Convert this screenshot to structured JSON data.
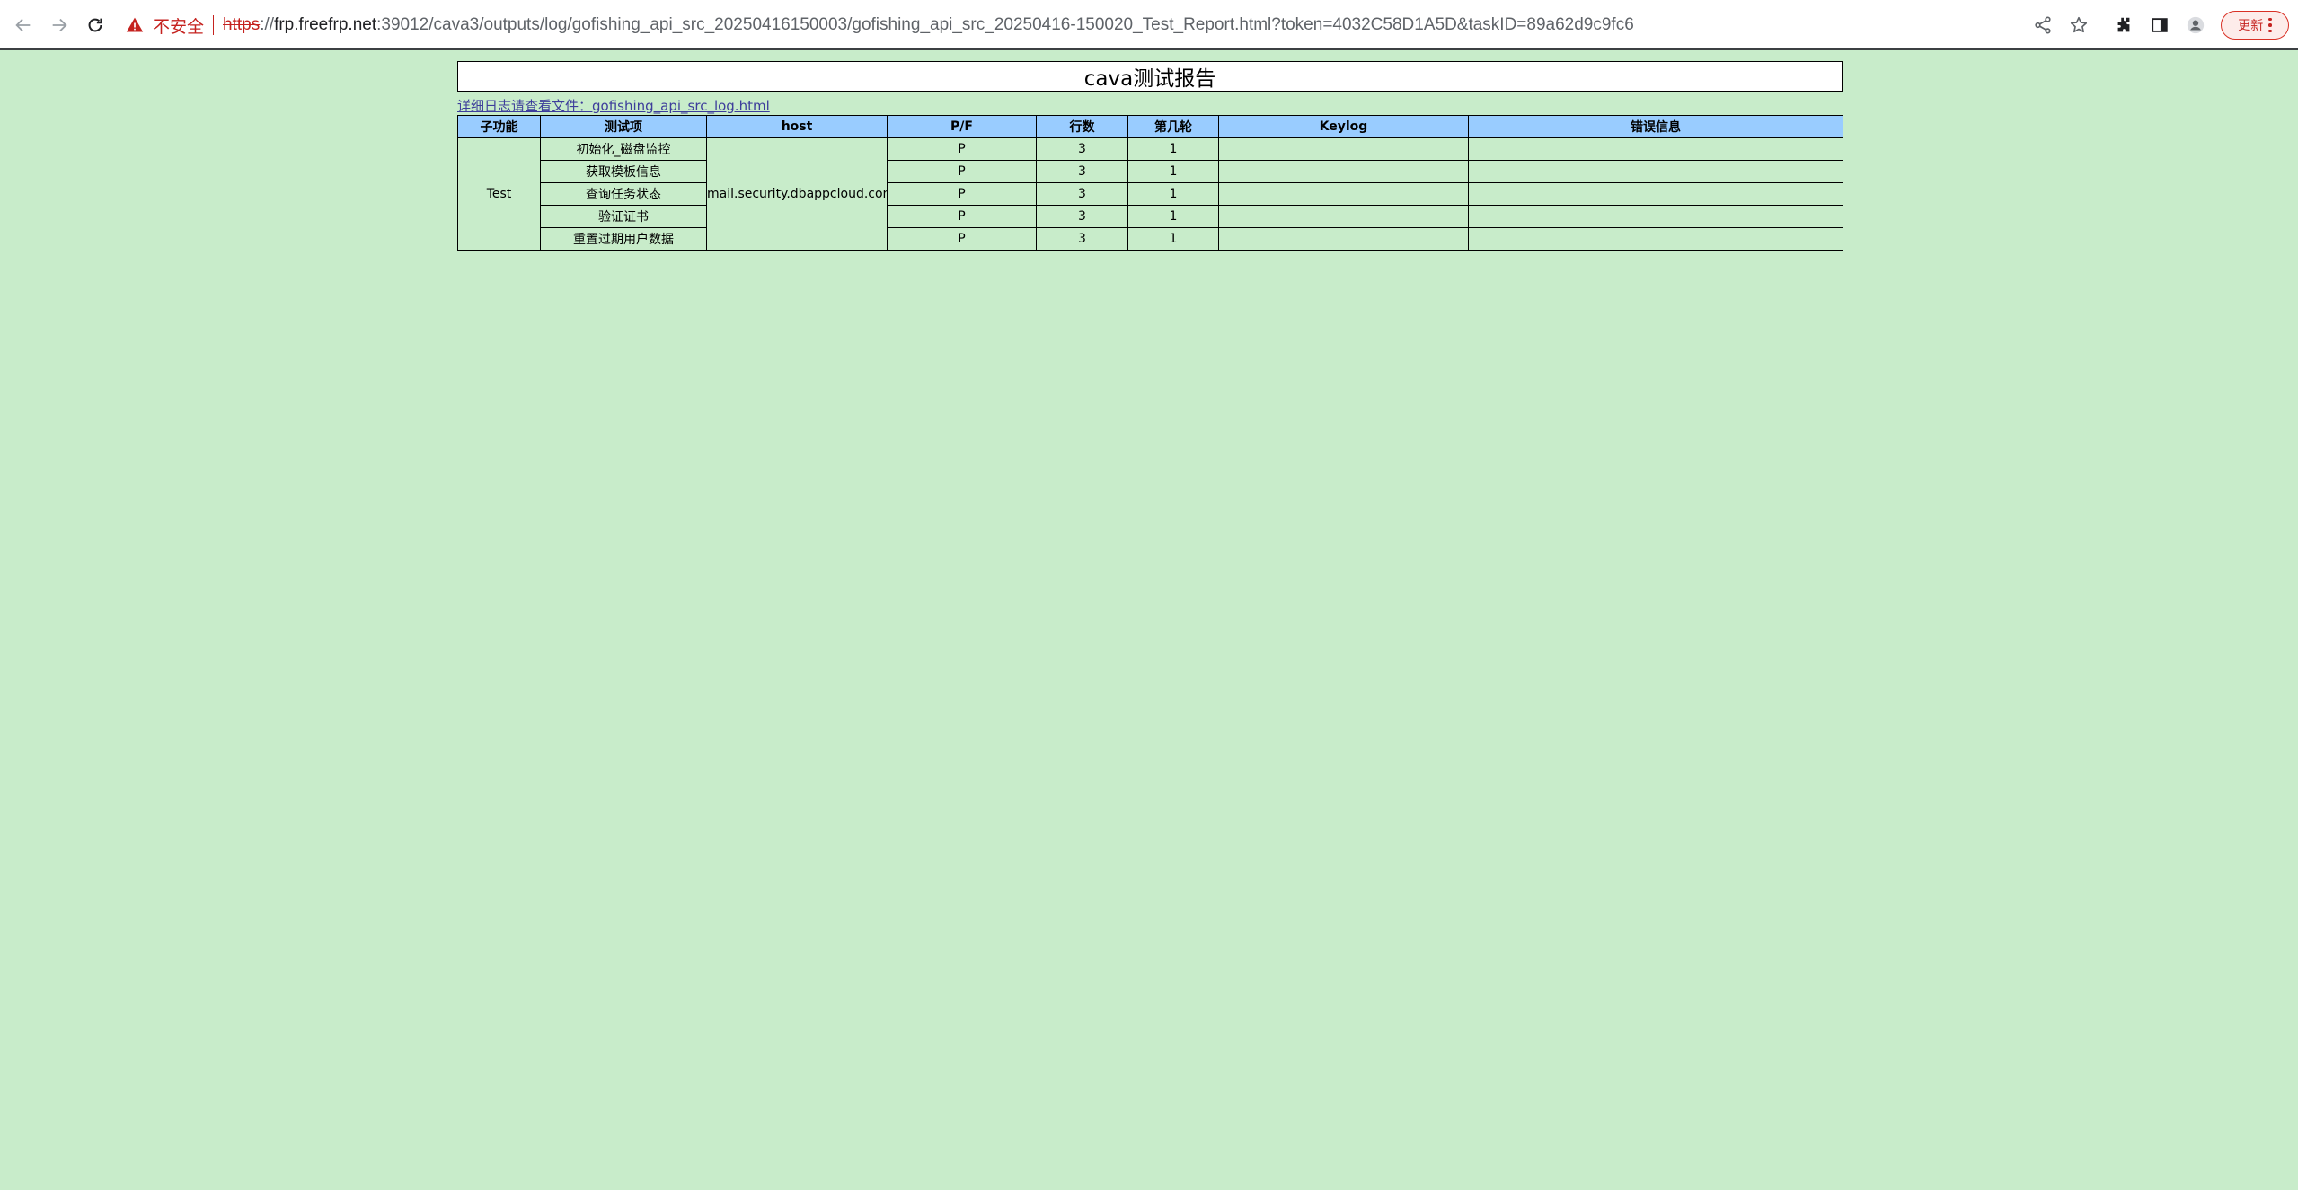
{
  "browser": {
    "security_label": "不安全",
    "url_protocol": "https",
    "url_protocol_sep": "://",
    "url_host": "frp.freefrp.net",
    "url_rest": ":39012/cava3/outputs/log/gofishing_api_src_20250416150003/gofishing_api_src_20250416-150020_Test_Report.html?token=4032C58D1A5D&taskID=89a62d9c9fc6",
    "update_label": "更新"
  },
  "report": {
    "title": "cava测试报告",
    "log_link": "详细日志请查看文件：gofishing_api_src_log.html",
    "columns": [
      "子功能",
      "测试项",
      "host",
      "P/F",
      "行数",
      "第几轮",
      "Keylog",
      "错误信息"
    ],
    "group": "Test",
    "host": "mail.security.dbappcloud.com",
    "rows": [
      {
        "item": "初始化_磁盘监控",
        "pf": "P",
        "lines": "3",
        "round": "1",
        "keylog": "",
        "error": ""
      },
      {
        "item": "获取模板信息",
        "pf": "P",
        "lines": "3",
        "round": "1",
        "keylog": "",
        "error": ""
      },
      {
        "item": "查询任务状态",
        "pf": "P",
        "lines": "3",
        "round": "1",
        "keylog": "",
        "error": ""
      },
      {
        "item": "验证证书",
        "pf": "P",
        "lines": "3",
        "round": "1",
        "keylog": "",
        "error": ""
      },
      {
        "item": "重置过期用户数据",
        "pf": "P",
        "lines": "3",
        "round": "1",
        "keylog": "",
        "error": ""
      }
    ]
  }
}
